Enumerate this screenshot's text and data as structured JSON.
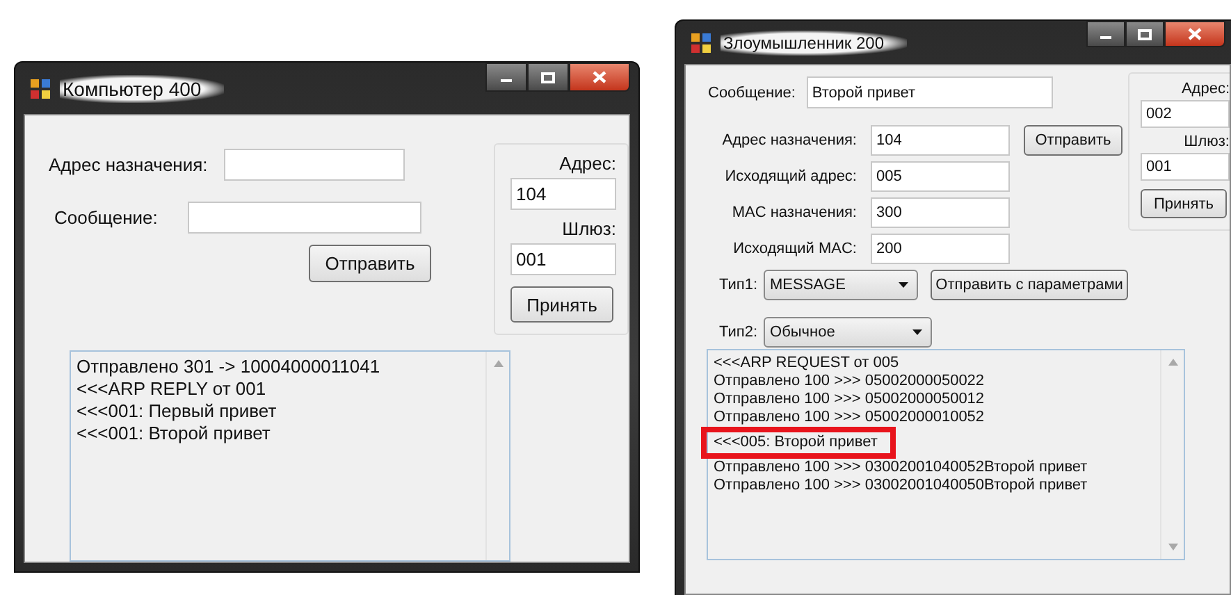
{
  "computer_window": {
    "title": "Компьютер 400",
    "fields": [
      {
        "label": "Адрес назначения:"
      },
      {
        "label": "Сообщение:"
      }
    ],
    "send_button": "Отправить",
    "node_group": {
      "address_label": "Адрес:",
      "address": "104",
      "gateway_label": "Шлюз:",
      "gateway": "001",
      "accept_button": "Принять"
    },
    "log": [
      {
        "text": "Отправлено 301 -> 10004000011041",
        "highlighted": false
      },
      {
        "text": "<<<ARP REPLY от 001",
        "highlighted": false
      },
      {
        "text": "<<<001: Первый привет",
        "highlighted": false
      },
      {
        "text": "<<<001: Второй привет",
        "highlighted": false
      }
    ]
  },
  "attacker_window": {
    "title": "Злоумышленник 200",
    "message": {
      "label": "Сообщение:",
      "value": "Второй привет"
    },
    "fields": [
      {
        "label": "Адрес назначения:",
        "value": "104"
      },
      {
        "label": "Исходящий адрес:",
        "value": "005"
      },
      {
        "label": "MAC назначения:",
        "value": "300"
      },
      {
        "label": "Исходящий MAC:",
        "value": "200"
      }
    ],
    "send_button": "Отправить",
    "type1": {
      "label": "Тип1:",
      "value": "MESSAGE"
    },
    "send_params_button": "Отправить с параметрами",
    "type2": {
      "label": "Тип2:",
      "value": "Обычное"
    },
    "node_group": {
      "address_label": "Адрес:",
      "address": "002",
      "gateway_label": "Шлюз:",
      "gateway": "001",
      "accept_button": "Принять"
    },
    "log": [
      {
        "text": "<<<ARP REQUEST от 005",
        "highlighted": false
      },
      {
        "text": "Отправлено 100 >>> 05002000050022",
        "highlighted": false
      },
      {
        "text": "Отправлено 100 >>> 05002000050012",
        "highlighted": false
      },
      {
        "text": "Отправлено 100 >>> 05002000010052",
        "highlighted": false
      },
      {
        "text": "<<<005: Второй привет",
        "highlighted": true
      },
      {
        "text": "Отправлено 100 >>> 03002001040052Второй привет",
        "highlighted": false
      },
      {
        "text": "Отправлено 100 >>> 03002001040050Второй привет",
        "highlighted": false
      }
    ]
  }
}
